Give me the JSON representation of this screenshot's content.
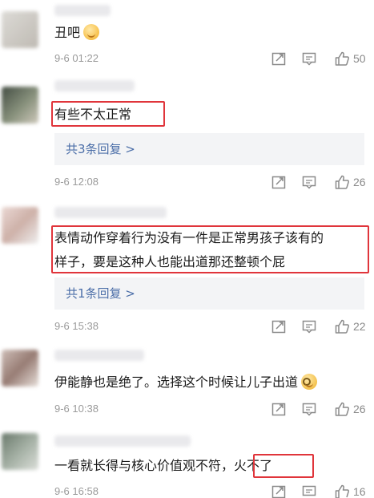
{
  "comments": [
    {
      "text": "丑吧",
      "time": "9-6 01:22",
      "likes": "50"
    },
    {
      "text": "有些不太正常",
      "reply": "共3条回复 >",
      "time": "9-6 12:08",
      "likes": "26"
    },
    {
      "text_line1": "表情动作穿着行为没有一件是正常男孩子该有的",
      "text_line2": "样子，要是这种人也能出道那还整顿个屁",
      "reply": "共1条回复 >",
      "time": "9-6 15:38",
      "likes": "22"
    },
    {
      "text": "伊能静也是绝了。选择这个时候让儿子出道",
      "time": "9-6 10:38",
      "likes": "26"
    },
    {
      "text_main": "一看就长得与核心价值观不符，",
      "text_highlight": "火不了",
      "time": "9-6 16:58",
      "likes": "16"
    }
  ],
  "icons": {
    "share": "share-icon",
    "comment": "comment-icon",
    "like": "thumbs-up-icon",
    "emoji_shy": "shy-face-emoji",
    "emoji_glasses": "glasses-face-emoji"
  },
  "colors": {
    "highlight": "#e0353b",
    "link": "#4b6ea8",
    "meta": "#9a9a9a"
  }
}
